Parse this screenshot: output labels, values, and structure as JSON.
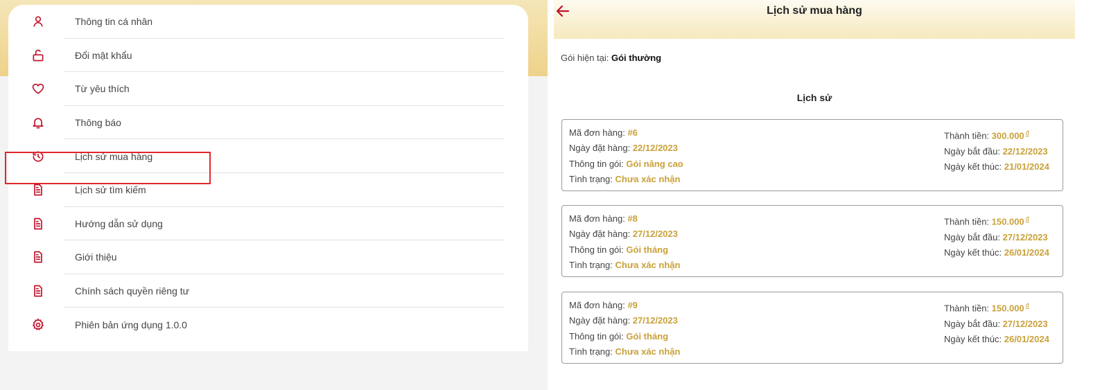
{
  "menu": {
    "items": [
      {
        "label": "Thông tin cá nhân",
        "icon": "user-icon"
      },
      {
        "label": "Đổi mật khẩu",
        "icon": "unlock-icon"
      },
      {
        "label": "Từ yêu thích",
        "icon": "heart-icon"
      },
      {
        "label": "Thông báo",
        "icon": "bell-icon"
      },
      {
        "label": "Lịch sử mua hàng",
        "icon": "history-icon"
      },
      {
        "label": "Lịch sử tìm kiếm",
        "icon": "document-icon"
      },
      {
        "label": "Hướng dẫn sử dụng",
        "icon": "document-icon"
      },
      {
        "label": "Giới thiệu",
        "icon": "document-icon"
      },
      {
        "label": "Chính sách quyền riêng tư",
        "icon": "document-icon"
      },
      {
        "label": "Phiên bản ứng dụng 1.0.0",
        "icon": "gear-icon"
      }
    ],
    "highlighted_index": 4
  },
  "purchase_history": {
    "title": "Lịch sử mua hàng",
    "current_plan_label": "Gói hiện tại:",
    "current_plan_value": "Gói thường",
    "history_heading": "Lịch sử",
    "labels": {
      "order_id": "Mã đơn hàng:",
      "order_date": "Ngày đặt hàng:",
      "plan_info": "Thông tin gói:",
      "status": "Tình trạng:",
      "total": "Thành tiền:",
      "start_date": "Ngày bắt đầu:",
      "end_date": "Ngày kết thúc:"
    },
    "currency_symbol": "đ",
    "orders": [
      {
        "order_id": "#6",
        "order_date": "22/12/2023",
        "plan_info": "Gói nâng cao",
        "status": "Chưa xác nhận",
        "total": "300.000",
        "start_date": "22/12/2023",
        "end_date": "21/01/2024"
      },
      {
        "order_id": "#8",
        "order_date": "27/12/2023",
        "plan_info": "Gói tháng",
        "status": "Chưa xác nhận",
        "total": "150.000",
        "start_date": "27/12/2023",
        "end_date": "26/01/2024"
      },
      {
        "order_id": "#9",
        "order_date": "27/12/2023",
        "plan_info": "Gói tháng",
        "status": "Chưa xác nhận",
        "total": "150.000",
        "start_date": "27/12/2023",
        "end_date": "26/01/2024"
      }
    ]
  },
  "colors": {
    "accent_red": "#c0122a",
    "gold_value": "#c9a13a",
    "highlight_border": "#e0262b"
  }
}
